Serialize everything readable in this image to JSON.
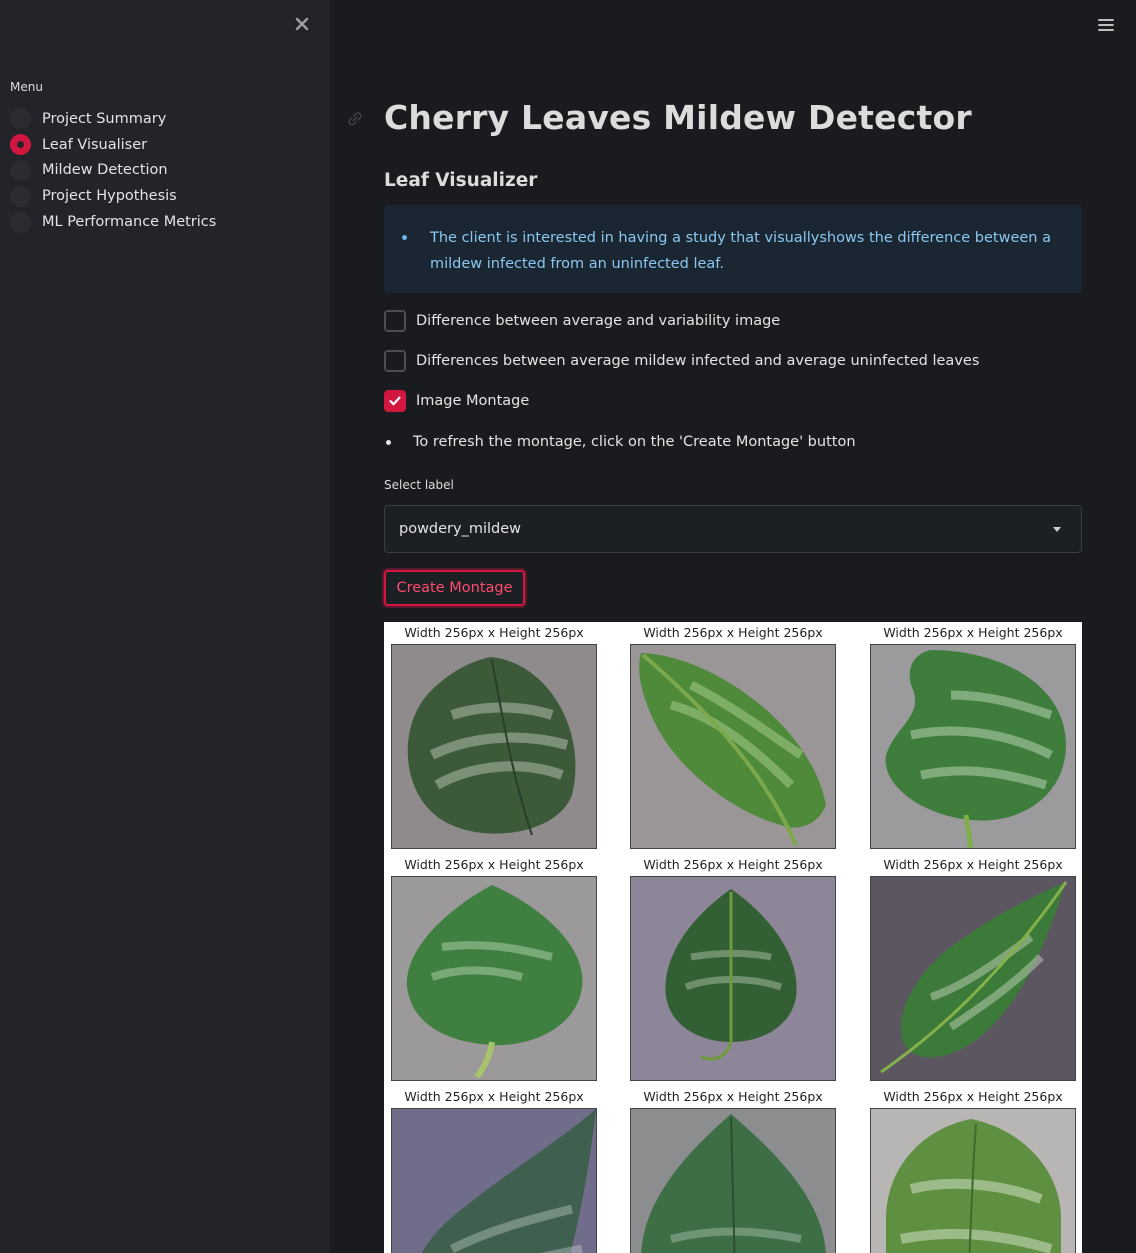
{
  "sidebar": {
    "menu_title": "Menu",
    "items": [
      {
        "label": "Project Summary",
        "active": false
      },
      {
        "label": "Leaf Visualiser",
        "active": true
      },
      {
        "label": "Mildew Detection",
        "active": false
      },
      {
        "label": "Project Hypothesis",
        "active": false
      },
      {
        "label": "ML Performance Metrics",
        "active": false
      }
    ]
  },
  "icons": {
    "close": "close-icon",
    "menu": "hamburger-menu-icon",
    "anchor": "link-icon",
    "caret": "chevron-down-icon",
    "check": "check-icon"
  },
  "main": {
    "title": "Cherry Leaves Mildew Detector",
    "section_title": "Leaf Visualizer",
    "info_text": "The client is interested in having a study that visuallyshows the difference between a mildew infected from an uninfected leaf.",
    "checkboxes": [
      {
        "label": "Difference between average and variability image",
        "checked": false
      },
      {
        "label": "Differences between average mildew infected and average uninfected leaves",
        "checked": false
      },
      {
        "label": "Image Montage",
        "checked": true
      }
    ],
    "bullet_text": "To refresh the montage, click on the 'Create Montage' button",
    "select": {
      "label": "Select label",
      "value": "powdery_mildew"
    },
    "create_button": "Create Montage",
    "montage": {
      "captions": [
        "Width 256px x Height 256px",
        "Width 256px x Height 256px",
        "Width 256px x Height 256px",
        "Width 256px x Height 256px",
        "Width 256px x Height 256px",
        "Width 256px x Height 256px",
        "Width 256px x Height 256px",
        "Width 256px x Height 256px",
        "Width 256px x Height 256px"
      ]
    }
  },
  "colors": {
    "accent": "#d1173f",
    "background": "#191b1f",
    "sidebar": "#22242a",
    "info_bg": "#1a2631",
    "info_text": "#8bc7f0"
  }
}
